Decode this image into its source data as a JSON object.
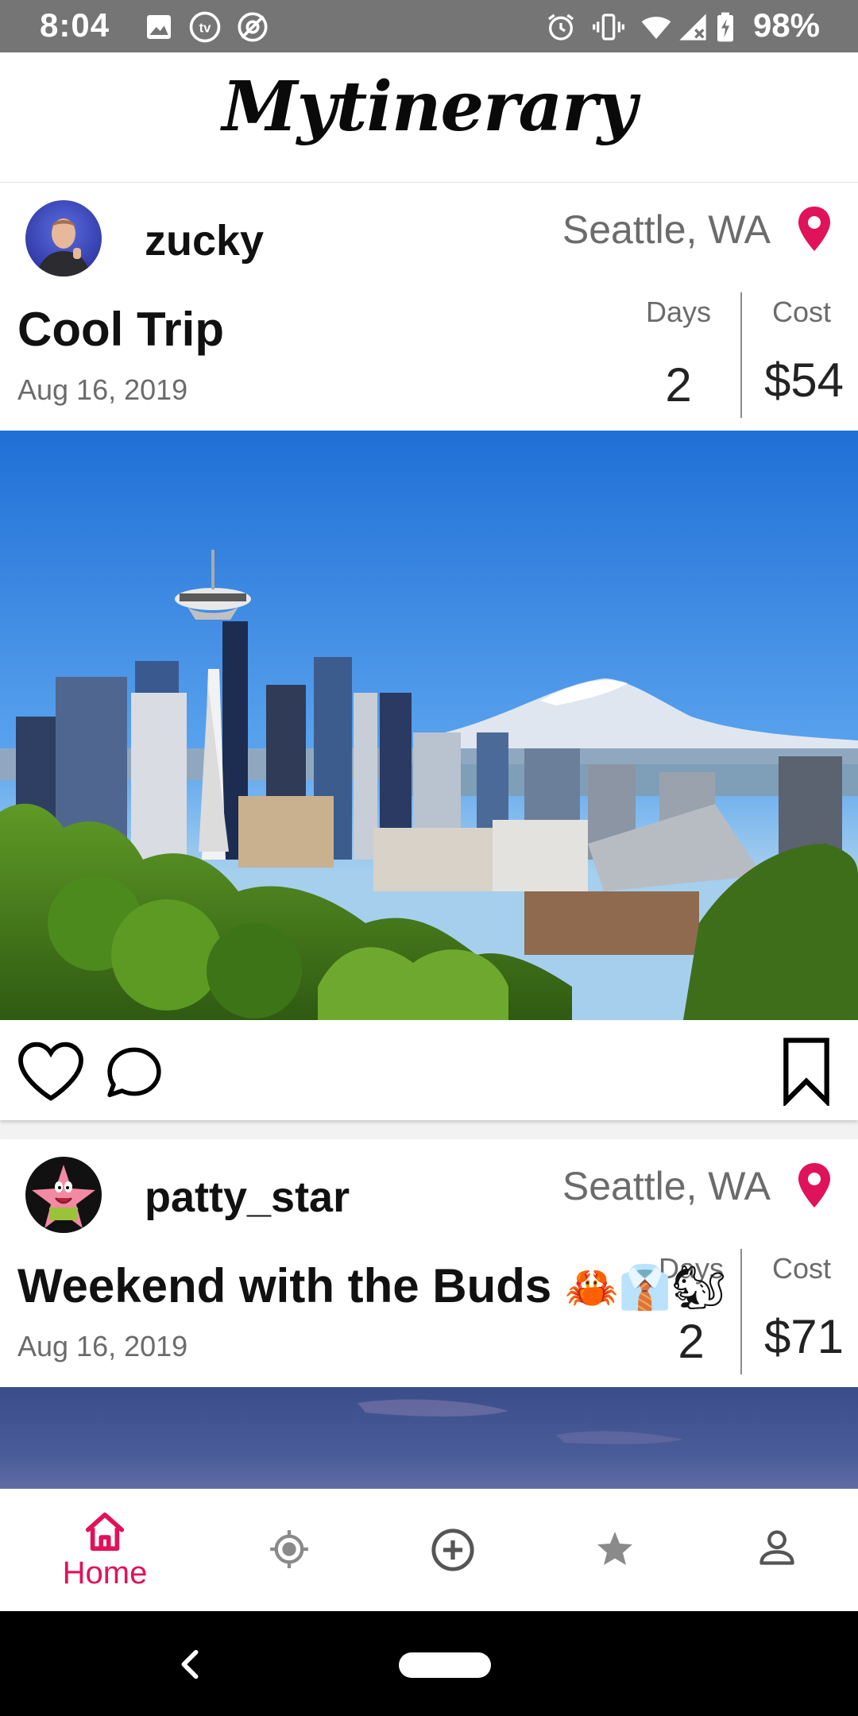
{
  "status_bar": {
    "time": "8:04",
    "battery_percent": "98%",
    "icons": [
      "image-icon",
      "tv-icon",
      "at-icon",
      "alarm-icon",
      "vibrate-icon",
      "wifi-icon",
      "signal-icon",
      "battery-icon"
    ]
  },
  "app": {
    "title": "Mytinerary",
    "accent_color": "#e0125a"
  },
  "posts": [
    {
      "username": "zucky",
      "location": "Seattle, WA",
      "title": "Cool Trip",
      "title_emoji": "",
      "date": "Aug 16, 2019",
      "days_label": "Days",
      "days": "2",
      "cost_label": "Cost",
      "cost": "$54"
    },
    {
      "username": "patty_star",
      "location": "Seattle, WA",
      "title": "Weekend with the Buds",
      "title_emoji": "🦀👔🐿",
      "date": "Aug 16, 2019",
      "days_label": "Days",
      "days": "2",
      "cost_label": "Cost",
      "cost": "$71"
    }
  ],
  "bottom_nav": {
    "home_label": "Home",
    "items": [
      "home-icon",
      "explore-icon",
      "add-icon",
      "favorites-icon",
      "profile-icon"
    ],
    "active": "home"
  }
}
